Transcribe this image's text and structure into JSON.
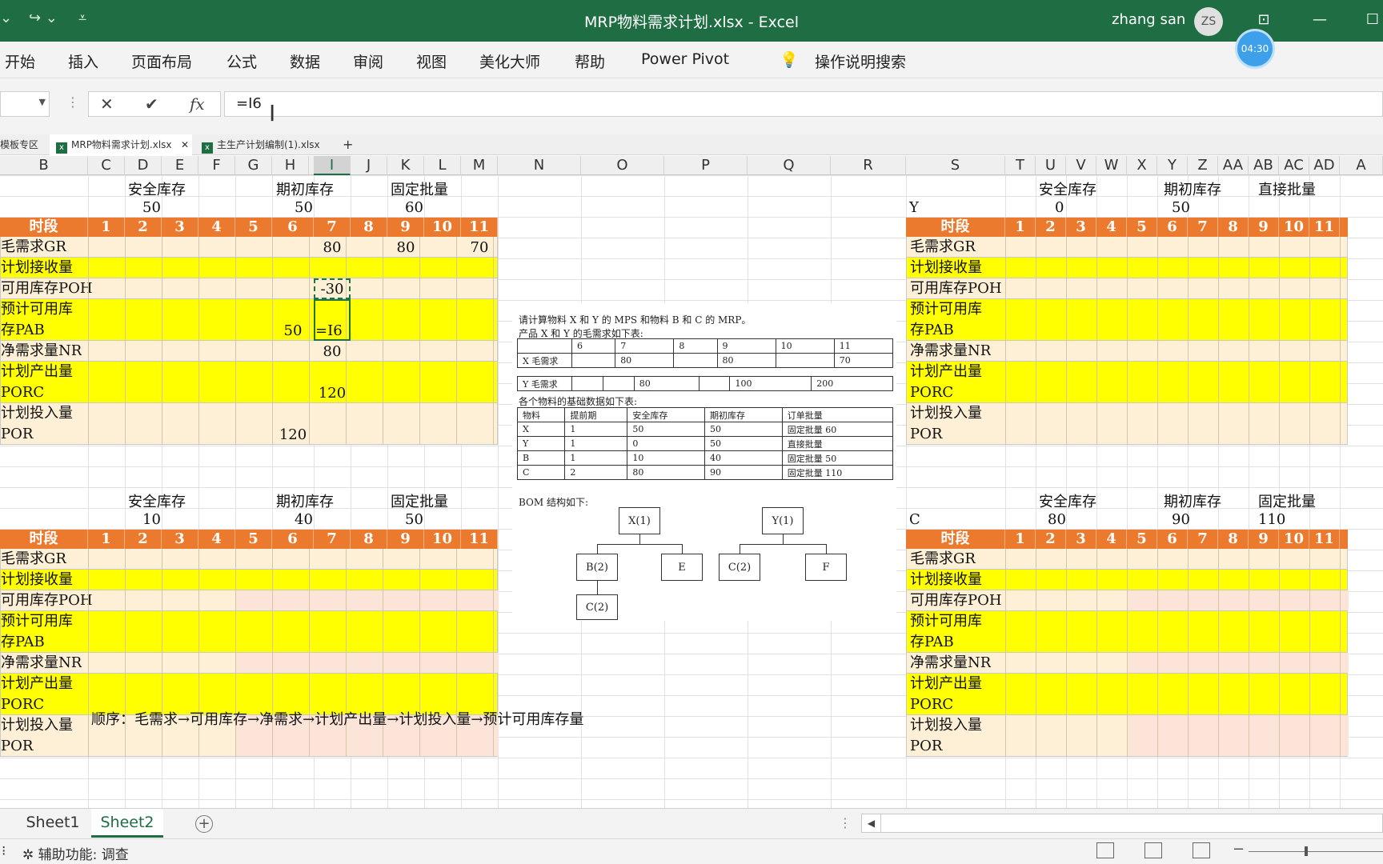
{
  "app": {
    "title": "MRP物料需求计划.xlsx  -  Excel",
    "user_name": "zhang san",
    "user_initials": "ZS",
    "timer": "04:30"
  },
  "ribbon": {
    "tabs": [
      "开始",
      "插入",
      "页面布局",
      "公式",
      "数据",
      "审阅",
      "视图",
      "美化大师",
      "帮助",
      "Power Pivot"
    ],
    "search": "操作说明搜索"
  },
  "formula_bar": {
    "cancel": "✕",
    "enter": "✔",
    "fx": "fx",
    "value": "=I6"
  },
  "workbook_tabs": [
    {
      "label": "模板专区"
    },
    {
      "label": "MRP物料需求计划.xlsx"
    },
    {
      "label": "主生产计划编制(1).xlsx"
    }
  ],
  "columns": [
    "B",
    "C",
    "D",
    "E",
    "F",
    "G",
    "H",
    "I",
    "J",
    "K",
    "L",
    "M",
    "N",
    "O",
    "P",
    "Q",
    "R",
    "S",
    "T",
    "U",
    "V",
    "W",
    "X",
    "Y",
    "Z",
    "AA",
    "AB",
    "AC",
    "AD",
    "A"
  ],
  "selected_column": "I",
  "periods": [
    "1",
    "2",
    "3",
    "4",
    "5",
    "6",
    "7",
    "8",
    "9",
    "10",
    "11"
  ],
  "row_labels": {
    "header": "时段",
    "gr": "毛需求GR",
    "sr": "计划接收量",
    "poh": "可用库存POH",
    "pab_1": "预计可用库",
    "pab_2": "存PAB",
    "nr": "净需求量NR",
    "porc_1": "计划产出量",
    "porc_2": "PORC",
    "por_1": "计划投入量",
    "por_2": "POR"
  },
  "blocks": {
    "x": {
      "param_labels": [
        "安全库存",
        "期初库存",
        "固定批量"
      ],
      "param_values": [
        "50",
        "50",
        "60"
      ],
      "gr_p7": "80",
      "gr_p9": "80",
      "gr_p11": "70",
      "poh_p7": "-30",
      "pab_p6": "50",
      "pab_p7_edit": "=I6",
      "nr_p7": "80",
      "porc_p7": "120",
      "por_p6": "120"
    },
    "y": {
      "name": "Y",
      "param_labels": [
        "安全库存",
        "期初库存",
        "直接批量"
      ],
      "param_values": [
        "0",
        "50"
      ]
    },
    "b": {
      "param_labels": [
        "安全库存",
        "期初库存",
        "固定批量"
      ],
      "param_values": [
        "10",
        "40",
        "50"
      ]
    },
    "c": {
      "name": "C",
      "param_labels": [
        "安全库存",
        "期初库存",
        "固定批量"
      ],
      "param_values": [
        "80",
        "90",
        "110"
      ]
    }
  },
  "problem": {
    "line1": "请计算物料 X 和 Y 的 MPS 和物料 B 和 C 的 MRP。",
    "line2": "产品 X 和 Y 的毛需求如下表:",
    "demand_header": [
      "",
      "6",
      "7",
      "8",
      "9",
      "10",
      "11"
    ],
    "x_demand": [
      "X 毛需求",
      "",
      "80",
      "",
      "80",
      "",
      "70"
    ],
    "y_demand": [
      "Y 毛需求",
      "",
      "",
      "80",
      "",
      "100",
      "200"
    ],
    "line3": "各个物料的基础数据如下表:",
    "base_header": [
      "物料",
      "提前期",
      "安全库存",
      "期初库存",
      "订单批量"
    ],
    "base_rows": [
      [
        "X",
        "1",
        "50",
        "50",
        "固定批量 60"
      ],
      [
        "Y",
        "1",
        "0",
        "50",
        "直接批量"
      ],
      [
        "B",
        "1",
        "10",
        "40",
        "固定批量 50"
      ],
      [
        "C",
        "2",
        "80",
        "90",
        "固定批量 110"
      ]
    ],
    "line4": "BOM 结构如下:",
    "bom": [
      "X(1)",
      "Y(1)",
      "B(2)",
      "E",
      "C(2)",
      "F",
      "C(2)"
    ]
  },
  "note": "顺序：毛需求→可用库存→净需求→计划产出量→计划投入量→预计可用库存量",
  "sheets": [
    "Sheet1",
    "Sheet2"
  ],
  "status": {
    "accessibility": "辅助功能: 调查"
  }
}
